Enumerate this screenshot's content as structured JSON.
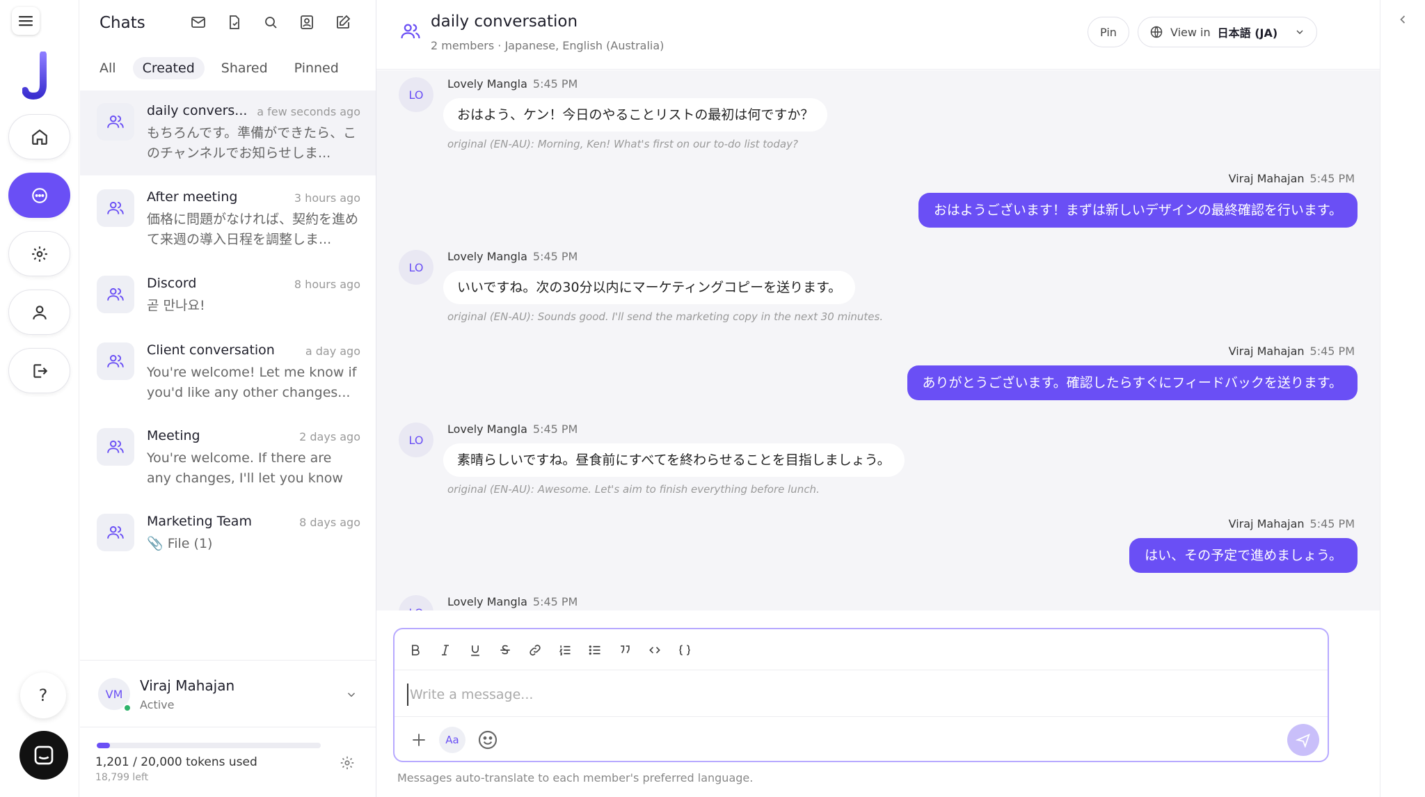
{
  "rail": {
    "logo_letter": "J",
    "help_label": "?"
  },
  "list": {
    "title": "Chats",
    "tabs": [
      {
        "label": "All",
        "selected": false
      },
      {
        "label": "Created",
        "selected": true
      },
      {
        "label": "Shared",
        "selected": false
      },
      {
        "label": "Pinned",
        "selected": false
      }
    ],
    "conversations": [
      {
        "name": "daily convers...",
        "time": "a few seconds ago",
        "preview": "もちろんです。準備ができたら、このチャンネルでお知らせしま...",
        "selected": true
      },
      {
        "name": "After meeting",
        "time": "3 hours ago",
        "preview": "価格に問題がなければ、契約を進めて来週の導入日程を調整しま..."
      },
      {
        "name": "Discord",
        "time": "8 hours ago",
        "preview": "곧 만나요!"
      },
      {
        "name": "Client conversation",
        "time": "a day ago",
        "preview": "You're welcome! Let me know if you'd like any other changes..."
      },
      {
        "name": "Meeting",
        "time": "2 days ago",
        "preview": "You're welcome. If there are any changes, I'll let you know again."
      },
      {
        "name": "Marketing Team",
        "time": "8 days ago",
        "preview": "📎 File (1)"
      }
    ],
    "user": {
      "initials": "VM",
      "name": "Viraj Mahajan",
      "status": "Active"
    },
    "tokens": {
      "used_text": "1,201 / 20,000 tokens used",
      "left_text": "18,799 left",
      "fraction_used": 0.06
    }
  },
  "channel": {
    "title": "daily conversation",
    "subtitle": "2 members · Japanese, English (Australia)",
    "pin_label": "Pin",
    "view_prefix": "View in",
    "view_language": "日本語 (JA)"
  },
  "messages": [
    {
      "side": "left",
      "initials": "LO",
      "sender": "Lovely Mangla",
      "time": "5:45 PM",
      "text": "おはよう、ケン！今日のやることリストの最初は何ですか？",
      "original": "original (EN-AU): Morning, Ken! What's first on our to-do list today?"
    },
    {
      "side": "right",
      "sender": "Viraj Mahajan",
      "time": "5:45 PM",
      "text": "おはようございます！まずは新しいデザインの最終確認を行います。"
    },
    {
      "side": "left",
      "initials": "LO",
      "sender": "Lovely Mangla",
      "time": "5:45 PM",
      "text": "いいですね。次の30分以内にマーケティングコピーを送ります。",
      "original": "original (EN-AU): Sounds good. I'll send the marketing copy in the next 30 minutes."
    },
    {
      "side": "right",
      "sender": "Viraj Mahajan",
      "time": "5:45 PM",
      "text": "ありがとうございます。確認したらすぐにフィードバックを送ります。"
    },
    {
      "side": "left",
      "initials": "LO",
      "sender": "Lovely Mangla",
      "time": "5:45 PM",
      "text": "素晴らしいですね。昼食前にすべてを終わらせることを目指しましょう。",
      "original": "original (EN-AU): Awesome. Let's aim to finish everything before lunch."
    },
    {
      "side": "right",
      "sender": "Viraj Mahajan",
      "time": "5:45 PM",
      "text": "はい、その予定で進めましょう。"
    },
    {
      "side": "left",
      "initials": "LO",
      "sender": "Lovely Mangla",
      "time": "5:45 PM"
    }
  ],
  "composer": {
    "placeholder": "Write a message...",
    "aa_label": "Aa",
    "hint": "Messages auto-translate to each member's preferred language."
  },
  "colors": {
    "accent": "#6a4ff5",
    "accent_light": "#c9bffa",
    "online": "#2fb36b"
  }
}
